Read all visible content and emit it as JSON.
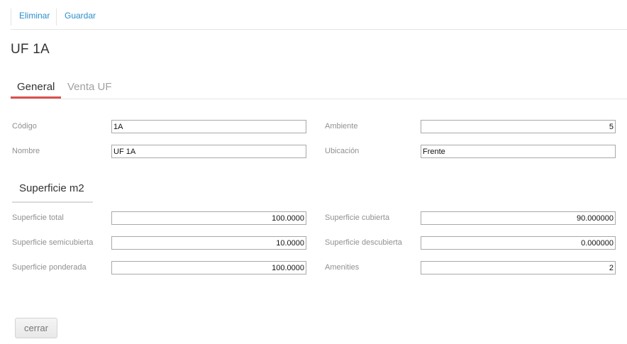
{
  "toolbar": {
    "delete_label": "Eliminar",
    "save_label": "Guardar"
  },
  "page_title": "UF 1A",
  "tabs": [
    {
      "label": "General",
      "active": true
    },
    {
      "label": "Venta UF",
      "active": false
    }
  ],
  "general": {
    "codigo": {
      "label": "Código",
      "value": "1A"
    },
    "nombre": {
      "label": "Nombre",
      "value": "UF 1A"
    },
    "ambiente": {
      "label": "Ambiente",
      "value": "5"
    },
    "ubicacion": {
      "label": "Ubicación",
      "value": "Frente"
    }
  },
  "superficie": {
    "title": "Superficie m2",
    "total": {
      "label": "Superficie total",
      "value": "100.0000"
    },
    "semicubierta": {
      "label": "Superficie semicubierta",
      "value": "10.0000"
    },
    "ponderada": {
      "label": "Superficie ponderada",
      "value": "100.0000"
    },
    "cubierta": {
      "label": "Superficie cubierta",
      "value": "90.000000"
    },
    "descubierta": {
      "label": "Superficie descubierta",
      "value": "0.000000"
    },
    "amenities": {
      "label": "Amenities",
      "value": "2"
    }
  },
  "footer": {
    "close_label": "cerrar"
  },
  "colors": {
    "link": "#2a8ec9",
    "tab_accent": "#d9534f"
  }
}
